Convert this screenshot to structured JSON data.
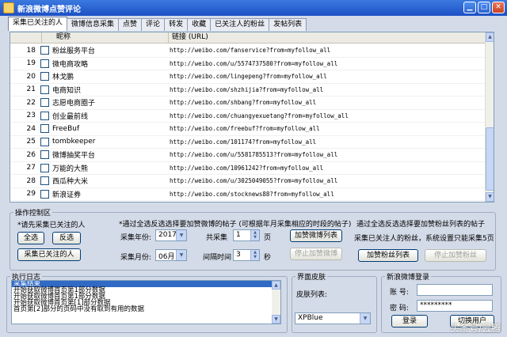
{
  "window": {
    "title": "新浪微博点赞评论",
    "min_icon": "minimize-icon",
    "max_icon": "maximize-icon",
    "close_icon": "close-icon"
  },
  "tabs": [
    {
      "label": "采集已关注的人",
      "active": true
    },
    {
      "label": "微博信息采集"
    },
    {
      "label": "点赞"
    },
    {
      "label": "评论"
    },
    {
      "label": "转发"
    },
    {
      "label": "收藏"
    },
    {
      "label": "已关注人的粉丝"
    },
    {
      "label": "发帖列表"
    }
  ],
  "list": {
    "columns": [
      "",
      "昵称",
      "链接 (URL)"
    ],
    "rows": [
      {
        "num": "18",
        "nick": "粉丝服务平台",
        "link": "http://weibo.com/fanservice?from=myfollow_all"
      },
      {
        "num": "19",
        "nick": "微电商攻略",
        "link": "http://weibo.com/u/5574737580?from=myfollow_all"
      },
      {
        "num": "20",
        "nick": "林戈鹏",
        "link": "http://weibo.com/lingepeng?from=myfollow_all"
      },
      {
        "num": "21",
        "nick": "电商知识",
        "link": "http://weibo.com/shzhijia?from=myfollow_all"
      },
      {
        "num": "22",
        "nick": "志愿电商圈子",
        "link": "http://weibo.com/shbang?from=myfollow_all"
      },
      {
        "num": "23",
        "nick": "创业最前线",
        "link": "http://weibo.com/chuangyexuetang?from=myfollow_all"
      },
      {
        "num": "24",
        "nick": "FreeBuf",
        "link": "http://weibo.com/freebuf?from=myfollow_all"
      },
      {
        "num": "25",
        "nick": "tombkeeper",
        "link": "http://weibo.com/101174?from=myfollow_all"
      },
      {
        "num": "26",
        "nick": "微博抽奖平台",
        "link": "http://weibo.com/u/5581785513?from=myfollow_all"
      },
      {
        "num": "27",
        "nick": "万能的大熊",
        "link": "http://weibo.com/10961242?from=myfollow_all"
      },
      {
        "num": "28",
        "nick": "西瓜种大米",
        "link": "http://weibo.com/u/3025049055?from=myfollow_all"
      },
      {
        "num": "29",
        "nick": "新浪证券",
        "link": "http://weibo.com/stocknews88?from=myfollow_all"
      }
    ]
  },
  "ops": {
    "legend": "操作控制区",
    "note1": "*请先采集已关注的人",
    "note2": "*通过全选反选选择要加赞微博的帖子 (可根据年月采集相应的时段的帖子)",
    "note3": "通过全选反选选择要加赞粉丝列表的帖子",
    "select_all": "全选",
    "invert": "反选",
    "collect_followed": "采集已关注的人",
    "year_label": "采集年份:",
    "year_value": "2017",
    "month_label": "采集月份:",
    "month_value": "06月",
    "total_label": "共采集",
    "total_value": "1",
    "page_unit": "页",
    "interval_label": "间隔时间",
    "interval_value": "3",
    "sec_unit": "秒",
    "add_weibo_list": "加赞微博列表",
    "stop_weibo": "停止加赞微博",
    "fans_note": "采集已关注人的粉丝，系统设置只能采集5页",
    "add_fans_list": "加赞粉丝列表",
    "stop_fans": "停止加赞粉丝"
  },
  "log": {
    "legend": "执行日志",
    "lines": [
      "采集结束",
      "开始获取微博首页第1部分数据",
      "开始获取微博首页第1部分数据",
      "开始获取微博首页第[1]部分数据",
      "首页第[2]部分的页码中没有取到有用的数据"
    ]
  },
  "skin": {
    "legend": "界面皮肤",
    "label": "皮肤列表:",
    "value": "XPBlue"
  },
  "login": {
    "legend": "新浪微博登录",
    "account_label": "账 号:",
    "password_label": "密 码:",
    "password_value": "*********",
    "login_btn": "登录",
    "switch_btn": "切换用户"
  },
  "watermark": "头条号/云腾"
}
